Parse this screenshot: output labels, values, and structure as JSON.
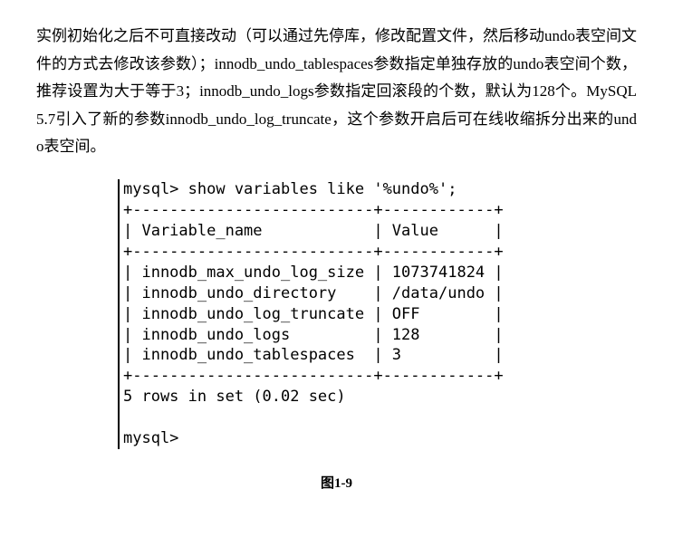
{
  "paragraph": "实例初始化之后不可直接改动（可以通过先停库，修改配置文件，然后移动undo表空间文件的方式去修改该参数）；innodb_undo_tablespaces参数指定单独存放的undo表空间个数，推荐设置为大于等于3；innodb_undo_logs参数指定回滚段的个数，默认为128个。MySQL 5.7引入了新的参数innodb_undo_log_truncate，这个参数开启后可在线收缩拆分出来的undo表空间。",
  "terminal": "mysql> show variables like '%undo%';\n+--------------------------+------------+\n| Variable_name            | Value      |\n+--------------------------+------------+\n| innodb_max_undo_log_size | 1073741824 |\n| innodb_undo_directory    | /data/undo |\n| innodb_undo_log_truncate | OFF        |\n| innodb_undo_logs         | 128        |\n| innodb_undo_tablespaces  | 3          |\n+--------------------------+------------+\n5 rows in set (0.02 sec)\n\nmysql>",
  "caption": "图1-9"
}
